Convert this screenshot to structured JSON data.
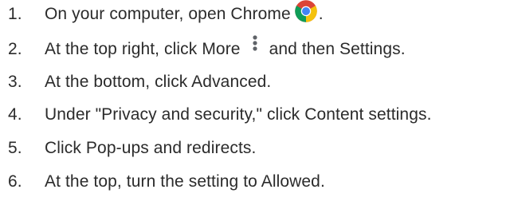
{
  "steps": [
    {
      "number": "1.",
      "text_before": "On your computer, open Chrome",
      "icon": "chrome-icon",
      "text_after": "."
    },
    {
      "number": "2.",
      "text_before": "At the top right, click More",
      "icon": "more-vertical-icon",
      "text_after": "and then Settings."
    },
    {
      "number": "3.",
      "text": "At the bottom, click Advanced."
    },
    {
      "number": "4.",
      "text": "Under \"Privacy and security,\" click Content settings."
    },
    {
      "number": "5.",
      "text": "Click Pop-ups and redirects."
    },
    {
      "number": "6.",
      "text": "At the top, turn the setting to Allowed."
    }
  ],
  "colors": {
    "text": "#2b2b2b",
    "chrome_red": "#db4437",
    "chrome_yellow": "#f4c20d",
    "chrome_green": "#0f9d58",
    "chrome_blue": "#4285f4",
    "more_dots": "#5f6368"
  }
}
